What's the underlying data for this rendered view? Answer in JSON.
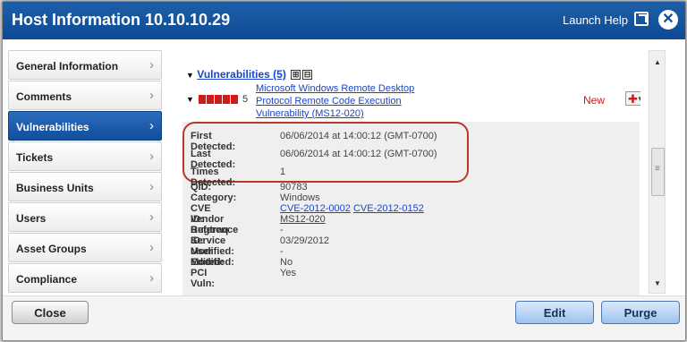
{
  "window": {
    "title": "Host Information 10.10.10.29",
    "help_label": "Launch Help"
  },
  "sidebar": {
    "items": [
      {
        "label": "General Information"
      },
      {
        "label": "Comments"
      },
      {
        "label": "Vulnerabilities",
        "active": true
      },
      {
        "label": "Tickets"
      },
      {
        "label": "Business Units"
      },
      {
        "label": "Users"
      },
      {
        "label": "Asset Groups"
      },
      {
        "label": "Compliance"
      }
    ]
  },
  "vulnerabilities": {
    "header": "Vulnerabilities (5)",
    "expand_icon": "⊞",
    "collapse_icon": "⊟",
    "item": {
      "severity": "5",
      "title": "Microsoft Windows Remote Desktop Protocol Remote Code Execution Vulnerability (MS12-020)",
      "status": "New",
      "add_icon": "✚"
    },
    "details": {
      "first_detected_label": "First Detected:",
      "first_detected": "06/06/2014 at 14:00:12 (GMT-0700)",
      "last_detected_label": "Last Detected:",
      "last_detected": "06/06/2014 at 14:00:12 (GMT-0700)",
      "times_detected_label": "Times Detected:",
      "times_detected": "1",
      "qid_label": "QID:",
      "qid": "90783",
      "category_label": "Category:",
      "category": "Windows",
      "cve_label": "CVE ID:",
      "cve_1": "CVE-2012-0002",
      "cve_2": "CVE-2012-0152",
      "vendor_ref_label": "Vendor Reference",
      "vendor_ref": "MS12-020",
      "bugtraq_label": "Bugtraq ID:",
      "bugtraq": "-",
      "service_modified_label": "Service Modified:",
      "service_modified": "03/29/2012",
      "user_modified_label": "User Modified:",
      "user_modified": "-",
      "edited_label": "Edited:",
      "edited": "No",
      "pci_label": "PCI Vuln:",
      "pci": "Yes"
    }
  },
  "footer": {
    "close_label": "Close",
    "edit_label": "Edit",
    "purge_label": "Purge"
  },
  "icons": {
    "chevron": "›",
    "close": "✕"
  },
  "colors": {
    "accent": "#1f5fa8",
    "highlight_ring": "#b5382b",
    "severity": "#d11b1b"
  }
}
